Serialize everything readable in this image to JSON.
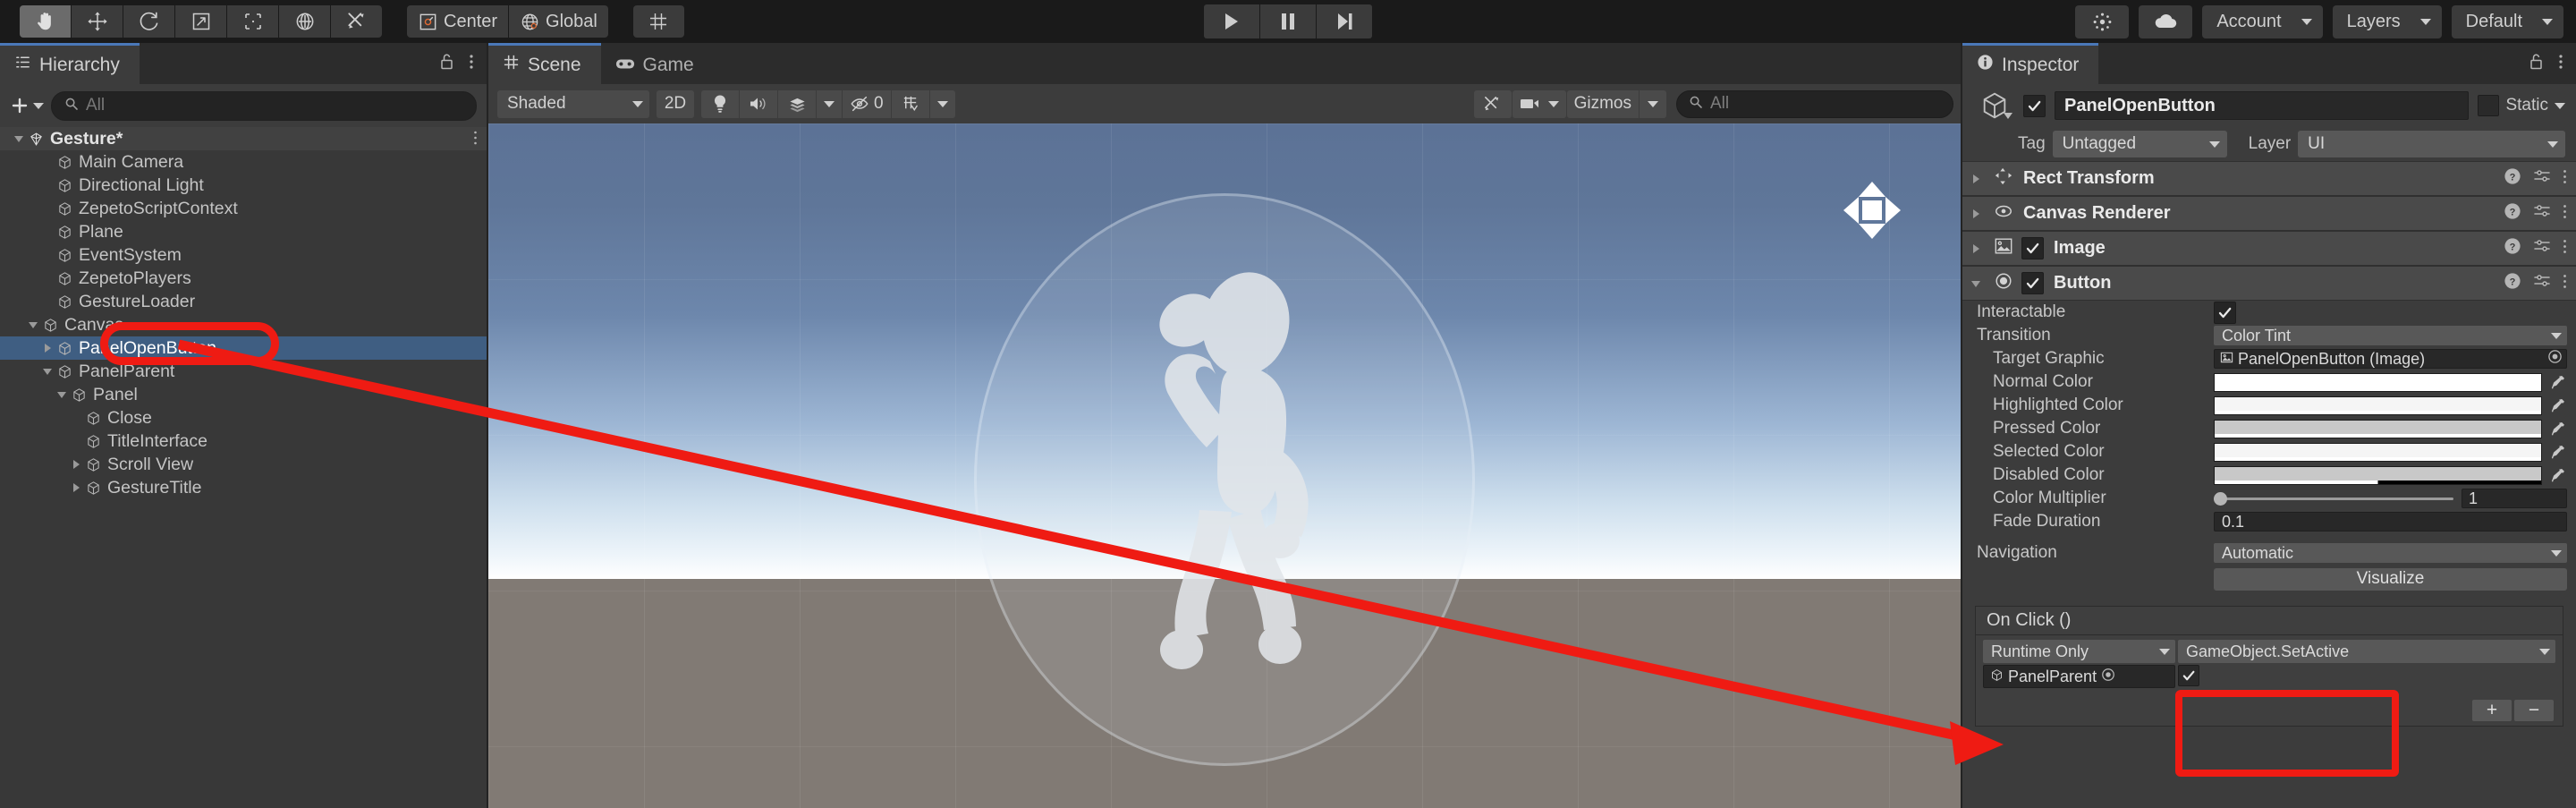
{
  "toolbar": {
    "tools": [
      {
        "name": "hand-tool",
        "label": "Hand",
        "active": true
      },
      {
        "name": "move-tool",
        "label": "Move",
        "active": false
      },
      {
        "name": "rotate-tool",
        "label": "Rotate",
        "active": false
      },
      {
        "name": "scale-tool",
        "label": "Scale",
        "active": false
      },
      {
        "name": "rect-tool",
        "label": "Rect",
        "active": false
      },
      {
        "name": "transform-tool",
        "label": "Transform",
        "active": false
      },
      {
        "name": "custom-tool",
        "label": "Custom Editor Tool",
        "active": false
      }
    ],
    "pivot_label": "Center",
    "handle_label": "Global",
    "grid_label": "Grid Snapping",
    "play": "▶",
    "pause": "‖",
    "step": "▶|",
    "search_icon": "search-icon",
    "account_label": "Account",
    "layers_label": "Layers",
    "layout_label": "Default",
    "cloud_icon": "cloud-icon",
    "services_icon": "services-icon"
  },
  "hierarchy": {
    "tab_label": "Hierarchy",
    "tab_icon": "hierarchy-icon",
    "lock_icon": "lock-icon",
    "menu_icon": "kebab-menu-icon",
    "add_label": "+",
    "search_placeholder": "All",
    "items": [
      {
        "label": "Gesture*",
        "depth": 0,
        "arrow": "open",
        "kind": "scene",
        "selected": false
      },
      {
        "label": "Main Camera",
        "depth": 2,
        "arrow": "none",
        "kind": "object",
        "selected": false
      },
      {
        "label": "Directional Light",
        "depth": 2,
        "arrow": "none",
        "kind": "object",
        "selected": false
      },
      {
        "label": "ZepetoScriptContext",
        "depth": 2,
        "arrow": "none",
        "kind": "object",
        "selected": false
      },
      {
        "label": "Plane",
        "depth": 2,
        "arrow": "none",
        "kind": "object",
        "selected": false
      },
      {
        "label": "EventSystem",
        "depth": 2,
        "arrow": "none",
        "kind": "object",
        "selected": false
      },
      {
        "label": "ZepetoPlayers",
        "depth": 2,
        "arrow": "none",
        "kind": "object",
        "selected": false
      },
      {
        "label": "GestureLoader",
        "depth": 2,
        "arrow": "none",
        "kind": "object",
        "selected": false
      },
      {
        "label": "Canvas",
        "depth": 1,
        "arrow": "open",
        "kind": "object",
        "selected": false
      },
      {
        "label": "PanelOpenButton",
        "depth": 2,
        "arrow": "closed",
        "kind": "object",
        "selected": true
      },
      {
        "label": "PanelParent",
        "depth": 2,
        "arrow": "open",
        "kind": "object",
        "selected": false
      },
      {
        "label": "Panel",
        "depth": 3,
        "arrow": "open",
        "kind": "object",
        "selected": false
      },
      {
        "label": "Close",
        "depth": 4,
        "arrow": "none",
        "kind": "object",
        "selected": false
      },
      {
        "label": "TitleInterface",
        "depth": 4,
        "arrow": "none",
        "kind": "object",
        "selected": false
      },
      {
        "label": "Scroll View",
        "depth": 4,
        "arrow": "closed",
        "kind": "object",
        "selected": false
      },
      {
        "label": "GestureTitle",
        "depth": 4,
        "arrow": "closed",
        "kind": "object",
        "selected": false
      }
    ]
  },
  "scene": {
    "tabs": [
      {
        "label": "Scene",
        "icon": "scene-grid-icon",
        "active": true
      },
      {
        "label": "Game",
        "icon": "gamepad-icon",
        "active": false
      }
    ],
    "lock_icon": "lock-icon",
    "menu_icon": "kebab-menu-icon",
    "draw_mode": "Shaded",
    "mode_2d": "2D",
    "lighting_icon": "lightbulb-icon",
    "audio_icon": "speaker-icon",
    "fx_icon": "effects-icon",
    "hidden_count": "0",
    "hidden_icon": "eye-off-icon",
    "grid_icon": "grid-visibility-icon",
    "tools_icon": "scene-tools-icon",
    "camera_icon": "scene-camera-icon",
    "gizmos_label": "Gizmos",
    "search_placeholder": "All",
    "view_gizmo": "2d-view-gizmo"
  },
  "inspector": {
    "tab_label": "Inspector",
    "tab_icon": "info-icon",
    "lock_icon": "lock-icon",
    "menu_icon": "kebab-menu-icon",
    "object_name": "PanelOpenButton",
    "object_enabled": true,
    "static_label": "Static",
    "static_checked": false,
    "tag_label": "Tag",
    "tag_value": "Untagged",
    "layer_label": "Layer",
    "layer_value": "UI",
    "components": [
      {
        "name": "Rect Transform",
        "icon": "rect-transform-icon",
        "expanded": false,
        "has_toggle": false
      },
      {
        "name": "Canvas Renderer",
        "icon": "canvas-renderer-icon",
        "expanded": false,
        "has_toggle": false
      },
      {
        "name": "Image",
        "icon": "image-icon",
        "expanded": false,
        "has_toggle": true,
        "enabled": true
      },
      {
        "name": "Button",
        "icon": "button-icon",
        "expanded": true,
        "has_toggle": true,
        "enabled": true
      }
    ],
    "button_props": {
      "interactable_label": "Interactable",
      "interactable_checked": true,
      "transition_label": "Transition",
      "transition_value": "Color Tint",
      "target_graphic_label": "Target Graphic",
      "target_graphic_value": "PanelOpenButton (Image)",
      "colors": [
        {
          "label": "Normal Color",
          "hex": "#FFFFFF",
          "alpha_hex": "#FFFFFF",
          "alpha_pct": 100
        },
        {
          "label": "Highlighted Color",
          "hex": "#F5F5F5",
          "alpha_hex": "#FFFFFF",
          "alpha_pct": 100
        },
        {
          "label": "Pressed Color",
          "hex": "#C8C8C8",
          "alpha_hex": "#FFFFFF",
          "alpha_pct": 100
        },
        {
          "label": "Selected Color",
          "hex": "#F5F5F5",
          "alpha_hex": "#FFFFFF",
          "alpha_pct": 100
        },
        {
          "label": "Disabled Color",
          "hex": "#C8C8C8",
          "alpha_hex": "#FFFFFF",
          "alpha_pct": 50
        }
      ],
      "color_multiplier_label": "Color Multiplier",
      "color_multiplier_value": "1",
      "fade_duration_label": "Fade Duration",
      "fade_duration_value": "0.1",
      "navigation_label": "Navigation",
      "navigation_value": "Automatic",
      "visualize_label": "Visualize"
    },
    "on_click": {
      "title": "On Click ()",
      "entries": [
        {
          "timing": "Runtime Only",
          "function": "GameObject.SetActive",
          "target_object": "PanelParent",
          "bool_arg": true
        }
      ],
      "add_label": "+",
      "remove_label": "−"
    }
  },
  "annotations": {
    "accent_color": "#EF1B13",
    "highlight_hierarchy_target": "PanelParent",
    "highlight_inspector_target": "GameObject.SetActive",
    "arrow": "red-arrow-pointer"
  }
}
